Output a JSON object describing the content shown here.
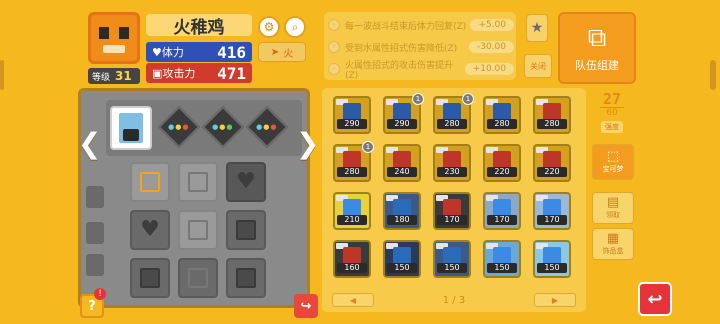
{
  "pokemon": {
    "name": "火稚鸡",
    "level_label": "等级",
    "level": "31",
    "hp_label": "体力",
    "hp": "416",
    "atk_label": "攻击力",
    "atk": "471",
    "type_label": "火"
  },
  "info_rows": [
    {
      "text": "每一波战斗结束后体力回复(Z)",
      "amount": "+5.00"
    },
    {
      "text": "受到水属性招式伤害降低(Z)",
      "amount": "-30.00"
    },
    {
      "text": "火属性招式的攻击伤害提升(Z)",
      "amount": "+10.00"
    }
  ],
  "buttons": {
    "toggle_label": "关闭",
    "team_label": "队伍组建",
    "capacity_current": "27",
    "capacity_max": "60",
    "capacity_label": "强度",
    "side1_label": "宝可梦",
    "side2_label": "领取",
    "side3_label": "饰品盒",
    "page": "1 / 3"
  },
  "stones": [
    {
      "val": "290",
      "color": "#d4a020",
      "gem": "#2a5aa8"
    },
    {
      "val": "290",
      "color": "#d4a020",
      "gem": "#2a5aa8",
      "badge": "1"
    },
    {
      "val": "280",
      "color": "#d4a020",
      "gem": "#2a5aa8",
      "badge": "1"
    },
    {
      "val": "280",
      "color": "#d4a020",
      "gem": "#2a5aa8"
    },
    {
      "val": "280",
      "color": "#d4a020",
      "gem": "#c0352a"
    },
    {
      "val": "280",
      "color": "#d4a020",
      "gem": "#c0352a",
      "badge": "1"
    },
    {
      "val": "240",
      "color": "#d4a020",
      "gem": "#c0352a"
    },
    {
      "val": "230",
      "color": "#d4a020",
      "gem": "#c0352a"
    },
    {
      "val": "220",
      "color": "#d4a020",
      "gem": "#c0352a"
    },
    {
      "val": "220",
      "color": "#d4a020",
      "gem": "#c0352a"
    },
    {
      "val": "210",
      "color": "#e6d23a",
      "gem": "#3a8ae6"
    },
    {
      "val": "180",
      "color": "#3a5a8a",
      "gem": "#2a6ab8"
    },
    {
      "val": "170",
      "color": "#3a3a3a",
      "gem": "#c0352a"
    },
    {
      "val": "170",
      "color": "#8aa8c8",
      "gem": "#3a8ae6"
    },
    {
      "val": "170",
      "color": "#9ab8d8",
      "gem": "#3a8ae6"
    },
    {
      "val": "160",
      "color": "#3a3a3a",
      "gem": "#c0352a"
    },
    {
      "val": "150",
      "color": "#2a3a5a",
      "gem": "#2a6ab8"
    },
    {
      "val": "150",
      "color": "#3a5a8a",
      "gem": "#2a6ab8"
    },
    {
      "val": "150",
      "color": "#6aa8d8",
      "gem": "#3a8ae6"
    },
    {
      "val": "150",
      "color": "#8ac8e8",
      "gem": "#3a8ae6"
    }
  ],
  "icons": {
    "gear": "gear-icon",
    "search": "search-icon",
    "fav": "star-icon",
    "back": "back-arrow-icon",
    "share": "share-icon",
    "help": "help-icon"
  }
}
